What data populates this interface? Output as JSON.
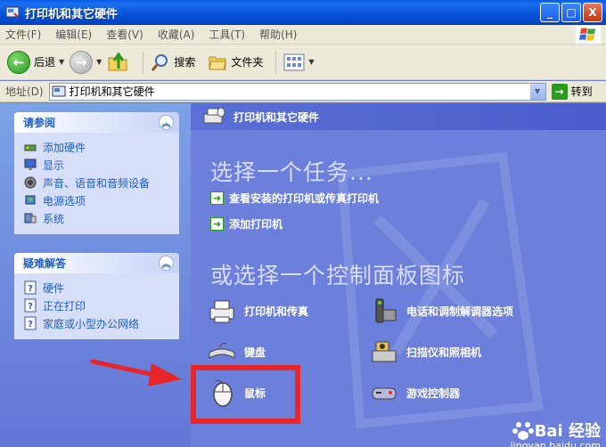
{
  "window": {
    "title": "打印机和其它硬件",
    "controls": [
      "_",
      "□",
      "X"
    ]
  },
  "menu": [
    "文件(F)",
    "编辑(E)",
    "查看(V)",
    "收藏(A)",
    "工具(T)",
    "帮助(H)"
  ],
  "toolbar": {
    "back_label": "后退",
    "search_label": "搜索",
    "folders_label": "文件夹"
  },
  "address": {
    "label": "地址(D)",
    "value": "打印机和其它硬件",
    "go_label": "转到"
  },
  "see_also": {
    "title": "请参阅",
    "items": [
      "添加硬件",
      "显示",
      "声音、语音和音频设备",
      "电源选项",
      "系统"
    ]
  },
  "troubleshoot": {
    "title": "疑难解答",
    "items": [
      "硬件",
      "正在打印",
      "家庭或小型办公网络"
    ]
  },
  "content": {
    "header": "打印机和其它硬件",
    "pick_task": "选择一个任务...",
    "tasks": [
      "查看安装的打印机或传真打印机",
      "添加打印机"
    ],
    "pick_icon": "或选择一个控制面板图标",
    "icons": [
      "打印机和传真",
      "电话和调制解调器选项",
      "键盘",
      "扫描仪和照相机",
      "鼠标",
      "游戏控制器"
    ]
  },
  "watermark": {
    "brand": "Bai 经验",
    "url": "jingyan.baidu.com"
  },
  "colors": {
    "highlight": "#e8262a",
    "link": "#215dc6",
    "content_bg": "#6b7fdb"
  }
}
